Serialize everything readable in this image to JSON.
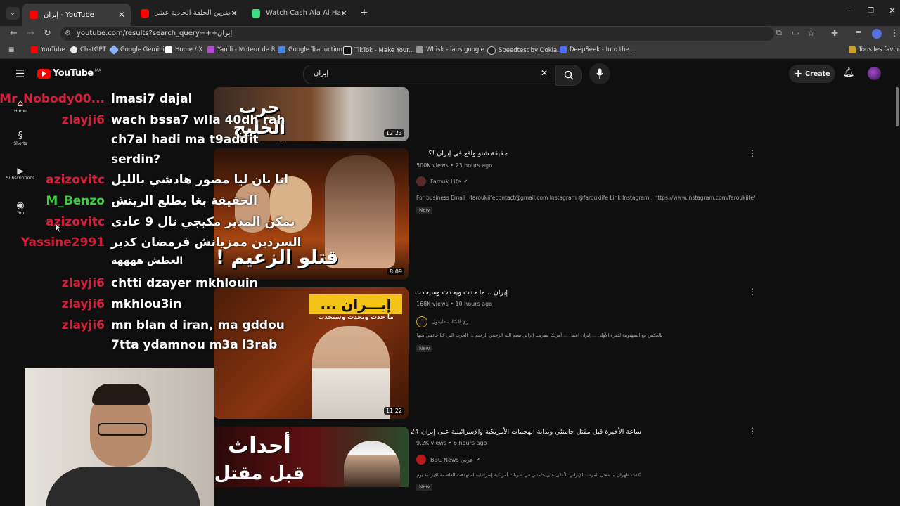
{
  "tabs": [
    {
      "title": "YouTube - إيران",
      "color": "#ff0000",
      "active": true
    },
    {
      "title": "مزالل حاضرين الحلقة الحادية عشر",
      "color": "#ff0000",
      "active": false
    },
    {
      "title": "Watch Cash Ala Al Hawaa - Sea",
      "color": "#3ddc84",
      "active": false
    }
  ],
  "address": "youtube.com/results?search_query=++إيران",
  "bookmarks": [
    "YouTube",
    "ChatGPT",
    "Google Gemini",
    "Home / X",
    "Yamli - Moteur de R...",
    "Google Traduction",
    "TikTok - Make Your...",
    "Whisk - labs.google...",
    "Speedtest by Ookla...",
    "DeepSeek - Into the..."
  ],
  "bookmarks_all": "Tous les favoris",
  "yt": {
    "logo": "YouTube",
    "country": "MA",
    "search_value": "إيران",
    "create": "Create",
    "sidebar": [
      "Home",
      "Shorts",
      "Subscriptions",
      "You"
    ]
  },
  "videos": [
    {
      "title": "",
      "duration": "12:23",
      "views": "",
      "channel": "",
      "desc": "",
      "new": ""
    },
    {
      "title": "حقيقة شنو واقع في إيران !؟",
      "duration": "8:09",
      "views": "500K views • 23 hours ago",
      "channel": "Farouk Life",
      "desc": "For business Email : faroukiifecontact@gmail.com Instagram @faroukiife Link Instagram : https://www.instagram.com/faroukiife/",
      "new": "New"
    },
    {
      "title": "إيران .. ما حدث ويحدث وسيحدث",
      "duration": "11:22",
      "views": "168K views • 10 hours ago",
      "channel": "زي الكتاب مايقول",
      "desc": "بالعكس مع الصهيونية للمرة الأولى ... إيران اعتيل ... أمريكا تضربت إيراني بسم الله الرحمن الرحيم ... الحرب التي كنا خائفين منها بدأت ومرت",
      "new": "New"
    },
    {
      "title": "ساعة الأخيرة قبل مقتل خامنئي وبداية الهجمات الأمريكية والإسرائيلية على إيران 24",
      "duration": "",
      "views": "9.2K views • 6 hours ago",
      "channel": "BBC News عربي",
      "desc": "أكدت طهران نبأ مقتل المرشد الإيراني الأعلى علي خامنئي في ضربات أمريكية إسرائيلية استهدفت العاصمة الإيرانية يوم السبت",
      "new": "New"
    }
  ],
  "thumb_text": {
    "t1": "حرب الخليج الرابعة",
    "t2": "قتلو الزعيم !",
    "t3": "إيـــران ...",
    "t3b": "ما حدث ويحدث وسيحدث",
    "t4": "أحداث",
    "t4b": "قبل مقتل"
  },
  "chat": [
    {
      "user": "Mr_Nobody00...",
      "color": "#d81e3a",
      "msg": "lmasi7 dajal"
    },
    {
      "user": "zlayji6",
      "color": "#d81e3a",
      "msg": "wach bssa7 wlla 40dh rah"
    },
    {
      "user": "",
      "color": "#d81e3a",
      "msg": "ch7al hadi ma t9addit"
    },
    {
      "user": "",
      "color": "#d81e3a",
      "msg": "serdin?"
    },
    {
      "user": "azizovitc",
      "color": "#d81e3a",
      "msg": "انا بان ليا مصور هادشي بالليل"
    },
    {
      "user": "M_Benzo",
      "color": "#37d03a",
      "msg": "الحقيقة بغا يطلع الريتش"
    },
    {
      "user": "azizovitc",
      "color": "#d81e3a",
      "msg": "يمكن المدير مكيجي تال 9 عادي"
    },
    {
      "user": "Yassine2991",
      "color": "#d81e3a",
      "msg": "السردين ممزيانش فرمضان كدير"
    },
    {
      "user": "",
      "color": "#d81e3a",
      "msg": "العطش ههههه"
    },
    {
      "user": "zlayji6",
      "color": "#d81e3a",
      "msg": "chtti dzayer mkhlouin"
    },
    {
      "user": "zlayji6",
      "color": "#d81e3a",
      "msg": "mkhlou3in"
    },
    {
      "user": "zlayji6",
      "color": "#d81e3a",
      "msg": "mn blan d iran, ma gddou"
    },
    {
      "user": "",
      "color": "#d81e3a",
      "msg": "7tta ydamnou m3a l3rab"
    }
  ]
}
